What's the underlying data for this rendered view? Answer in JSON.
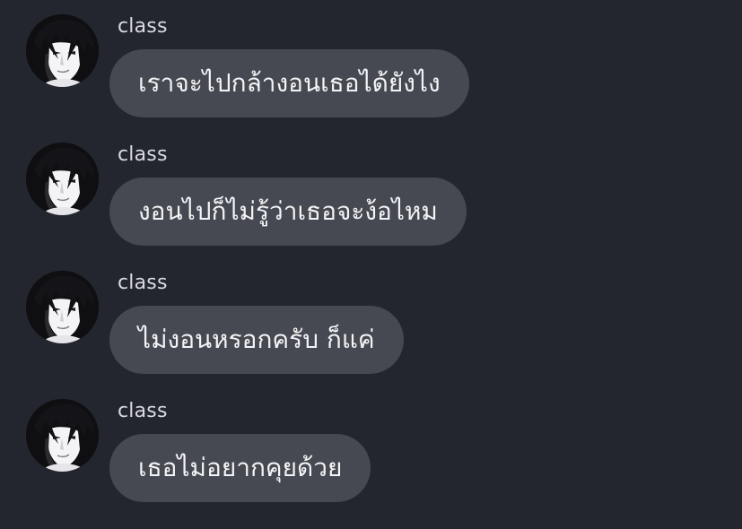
{
  "chat": {
    "messages": [
      {
        "sender": "class",
        "avatar_icon": "profile-avatar-icon",
        "text": "เราจะไปกล้างอนเธอได้ยังไง"
      },
      {
        "sender": "class",
        "avatar_icon": "profile-avatar-icon",
        "text": "งอนไปก็ไม่รู้ว่าเธอจะง้อไหม"
      },
      {
        "sender": "class",
        "avatar_icon": "profile-avatar-icon",
        "text": "ไม่งอนหรอกครับ ก็แค่"
      },
      {
        "sender": "class",
        "avatar_icon": "profile-avatar-icon",
        "text": "เธอไม่อยากคุยด้วย"
      }
    ]
  },
  "colors": {
    "background": "#23262e",
    "bubble": "#464951",
    "bubble_text": "#f3f4f6",
    "sender_text": "#d9dbe0"
  }
}
